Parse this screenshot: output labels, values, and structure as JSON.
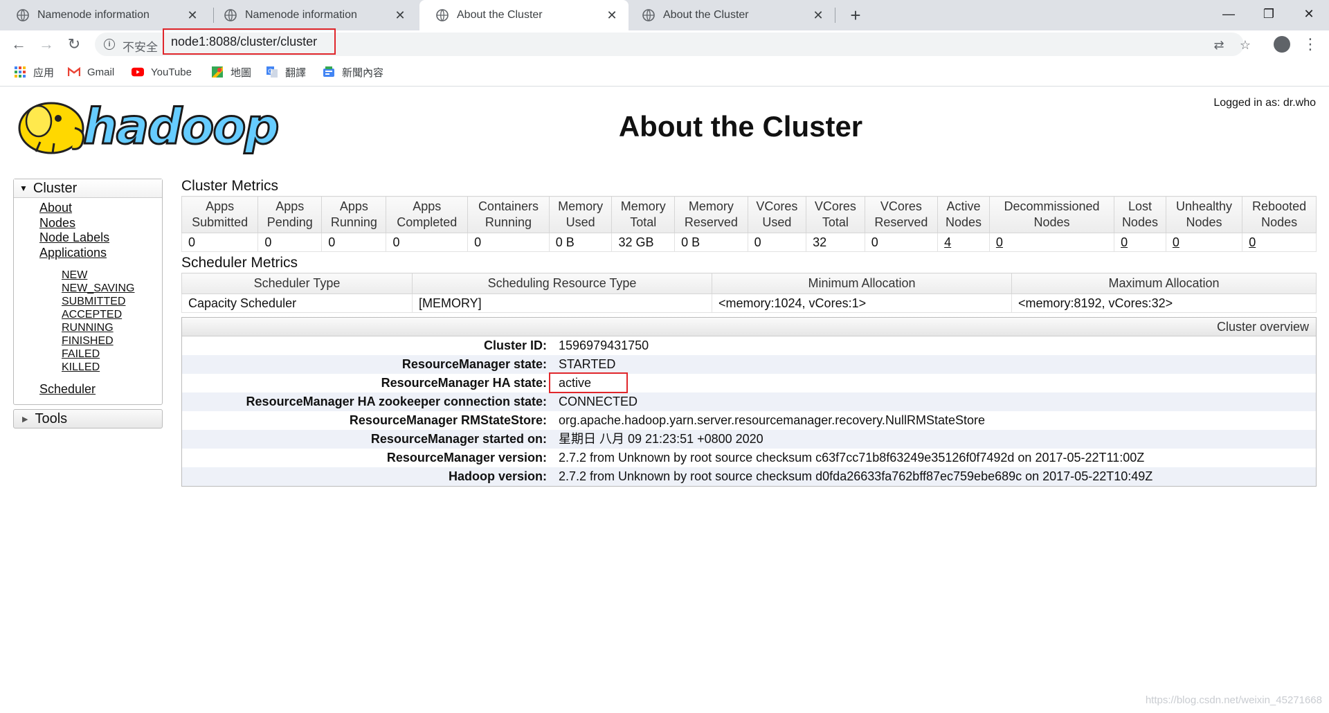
{
  "browser": {
    "tabs": [
      {
        "label": "Namenode information",
        "active": false
      },
      {
        "label": "Namenode information",
        "active": false
      },
      {
        "label": "About the Cluster",
        "active": true
      },
      {
        "label": "About the Cluster",
        "active": false
      }
    ],
    "insecure_label": "不安全",
    "url": "node1:8088/cluster/cluster",
    "bookmarks": [
      {
        "label": "应用",
        "icon": "apps-grid-icon"
      },
      {
        "label": "Gmail",
        "icon": "gmail-icon"
      },
      {
        "label": "YouTube",
        "icon": "youtube-icon"
      },
      {
        "label": "地圖",
        "icon": "maps-icon"
      },
      {
        "label": "翻譯",
        "icon": "translate-icon"
      },
      {
        "label": "新聞內容",
        "icon": "news-icon"
      }
    ]
  },
  "page": {
    "logged_in": "Logged in as: dr.who",
    "logo_text": "hadoop",
    "title": "About the Cluster"
  },
  "sidebar": {
    "cluster_header": "Cluster",
    "links": [
      "About",
      "Nodes",
      "Node Labels",
      "Applications"
    ],
    "app_states": [
      "NEW",
      "NEW_SAVING",
      "SUBMITTED",
      "ACCEPTED",
      "RUNNING",
      "FINISHED",
      "FAILED",
      "KILLED"
    ],
    "scheduler": "Scheduler",
    "tools_header": "Tools"
  },
  "cluster_metrics": {
    "title": "Cluster Metrics",
    "headers": [
      [
        "Apps",
        "Submitted"
      ],
      [
        "Apps",
        "Pending"
      ],
      [
        "Apps",
        "Running"
      ],
      [
        "Apps",
        "Completed"
      ],
      [
        "Containers",
        "Running"
      ],
      [
        "Memory",
        "Used"
      ],
      [
        "Memory",
        "Total"
      ],
      [
        "Memory",
        "Reserved"
      ],
      [
        "VCores",
        "Used"
      ],
      [
        "VCores",
        "Total"
      ],
      [
        "VCores",
        "Reserved"
      ],
      [
        "Active",
        "Nodes"
      ],
      [
        "Decommissioned",
        "Nodes"
      ],
      [
        "Lost",
        "Nodes"
      ],
      [
        "Unhealthy",
        "Nodes"
      ],
      [
        "Rebooted",
        "Nodes"
      ]
    ],
    "values": [
      "0",
      "0",
      "0",
      "0",
      "0",
      "0 B",
      "32 GB",
      "0 B",
      "0",
      "32",
      "0",
      "4",
      "0",
      "0",
      "0",
      "0"
    ]
  },
  "scheduler_metrics": {
    "title": "Scheduler Metrics",
    "headers": [
      "Scheduler Type",
      "Scheduling Resource Type",
      "Minimum Allocation",
      "Maximum Allocation"
    ],
    "values": [
      "Capacity Scheduler",
      "[MEMORY]",
      "<memory:1024, vCores:1>",
      "<memory:8192, vCores:32>"
    ]
  },
  "overview": {
    "title": "Cluster overview",
    "rows": [
      {
        "key": "Cluster ID:",
        "value": "1596979431750"
      },
      {
        "key": "ResourceManager state:",
        "value": "STARTED"
      },
      {
        "key": "ResourceManager HA state:",
        "value": "active"
      },
      {
        "key": "ResourceManager HA zookeeper connection state:",
        "value": "CONNECTED"
      },
      {
        "key": "ResourceManager RMStateStore:",
        "value": "org.apache.hadoop.yarn.server.resourcemanager.recovery.NullRMStateStore"
      },
      {
        "key": "ResourceManager started on:",
        "value": "星期日 八月 09 21:23:51 +0800 2020"
      },
      {
        "key": "ResourceManager version:",
        "value": "2.7.2 from Unknown by root source checksum c63f7cc71b8f63249e35126f0f7492d on 2017-05-22T11:00Z"
      },
      {
        "key": "Hadoop version:",
        "value": "2.7.2 from Unknown by root source checksum d0fda26633fa762bff87ec759ebe689c on 2017-05-22T10:49Z"
      }
    ]
  },
  "watermark": "https://blog.csdn.net/weixin_45271668"
}
